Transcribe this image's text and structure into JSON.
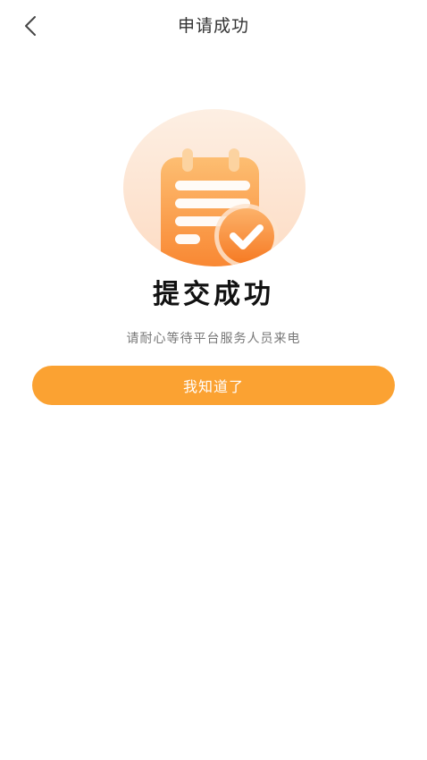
{
  "header": {
    "title": "申请成功",
    "back_icon": "chevron-left-icon"
  },
  "result": {
    "icon": "calendar-check-icon",
    "title": "提交成功",
    "description": "请耐心等待平台服务人员来电"
  },
  "actions": {
    "confirm_label": "我知道了"
  },
  "colors": {
    "accent": "#fba232",
    "illustration_bg": "#fde8d6"
  }
}
